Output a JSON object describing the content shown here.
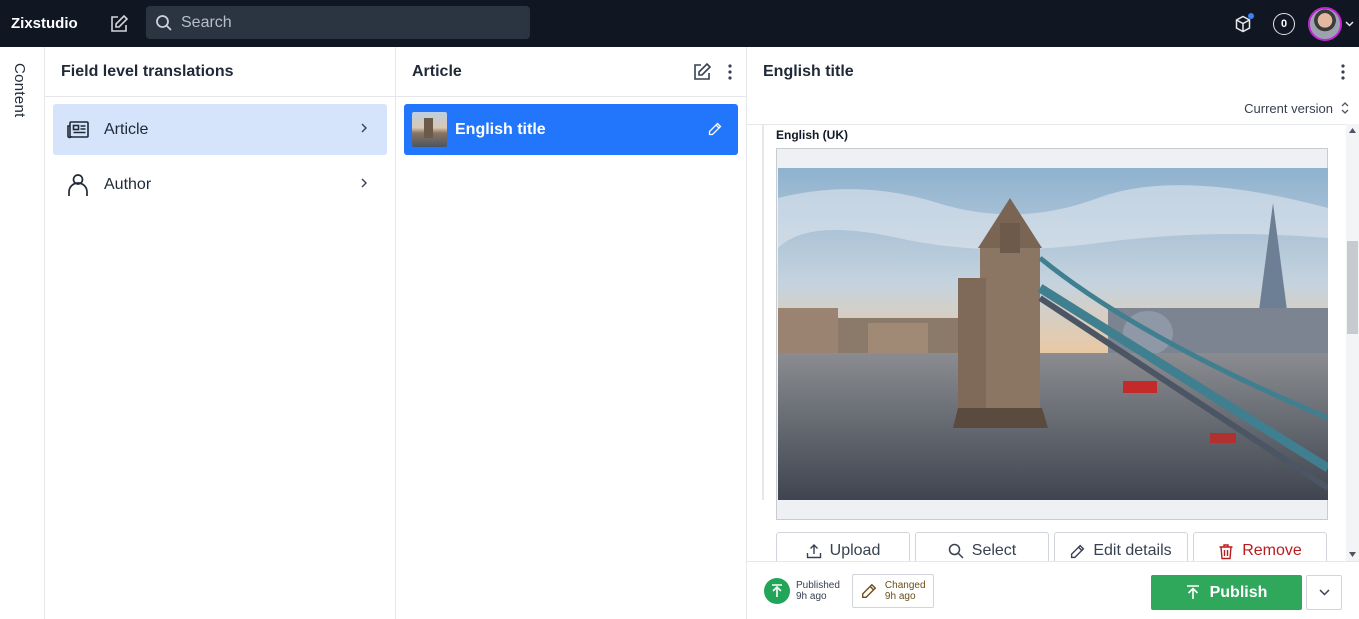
{
  "topbar": {
    "brand": "Zixstudio",
    "search_placeholder": "Search",
    "notification_count": "0"
  },
  "sidebar_tab": {
    "label": "Content"
  },
  "pane1": {
    "title": "Field level translations",
    "items": [
      {
        "label": "Article",
        "icon": "newspaper-icon",
        "active": true
      },
      {
        "label": "Author",
        "icon": "user-icon",
        "active": false
      }
    ]
  },
  "pane2": {
    "title": "Article",
    "documents": [
      {
        "label": "English title",
        "selected": true
      }
    ]
  },
  "pane3": {
    "title": "English title",
    "version_label": "Current version",
    "field_label": "English (UK)",
    "buttons": {
      "upload": "Upload",
      "select": "Select",
      "edit_details": "Edit details",
      "remove": "Remove"
    },
    "status": {
      "published_label": "Published",
      "published_time": "9h ago",
      "changed_label": "Changed",
      "changed_time": "9h ago"
    },
    "publish_label": "Publish"
  },
  "colors": {
    "topbar_bg": "#101723",
    "accent_blue": "#2276fc",
    "active_item_bg": "#d5e3fb",
    "publish_green": "#2fa85b",
    "danger_red": "#b91c1c"
  }
}
